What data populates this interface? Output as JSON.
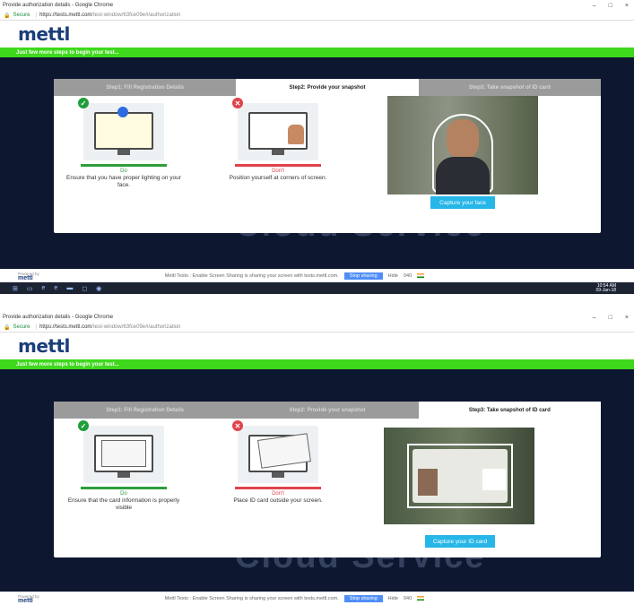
{
  "browser": {
    "title": "Provide authorization details - Google Chrome",
    "secure_label": "Secure",
    "url_host": "https://tests.mettl.com",
    "url_path": "/test-window/63fce09e#/authorization"
  },
  "header": {
    "logo": "mettl",
    "banner": "Just few more steps to begin your test..."
  },
  "background_text": "Cloud Service",
  "shots": [
    {
      "tabs": [
        "Step1: Fill Registration Details",
        "Step2: Provide your snapshot",
        "Step3: Take snapshot of ID card"
      ],
      "active_tab": 1,
      "do_label": "Do",
      "do_desc": "Ensure that you have proper lighting on your face.",
      "dont_label": "Don't",
      "dont_desc": "Position yourself at corners of screen.",
      "capture_label": "Capture your face"
    },
    {
      "tabs": [
        "Step1: Fill Registration Details",
        "Step2: Provide your snapshot",
        "Step3: Take snapshot of ID card"
      ],
      "active_tab": 2,
      "do_label": "Do",
      "do_desc": "Ensure that the card information is properly visible",
      "dont_label": "Don't",
      "dont_desc": "Place ID card outside your screen.",
      "capture_label": "Capture your ID card"
    }
  ],
  "footer": {
    "powered_by": "Powered by",
    "brand": "mettl",
    "share_text": "Mettl Tests : Enable Screen Sharing is sharing your screen with tests.mettl.com.",
    "stop_label": "Stop sharing",
    "hide_label": "Hide",
    "number": "040"
  },
  "taskbar": {
    "time": "10:54 AM",
    "date": "09-Jan-18"
  }
}
